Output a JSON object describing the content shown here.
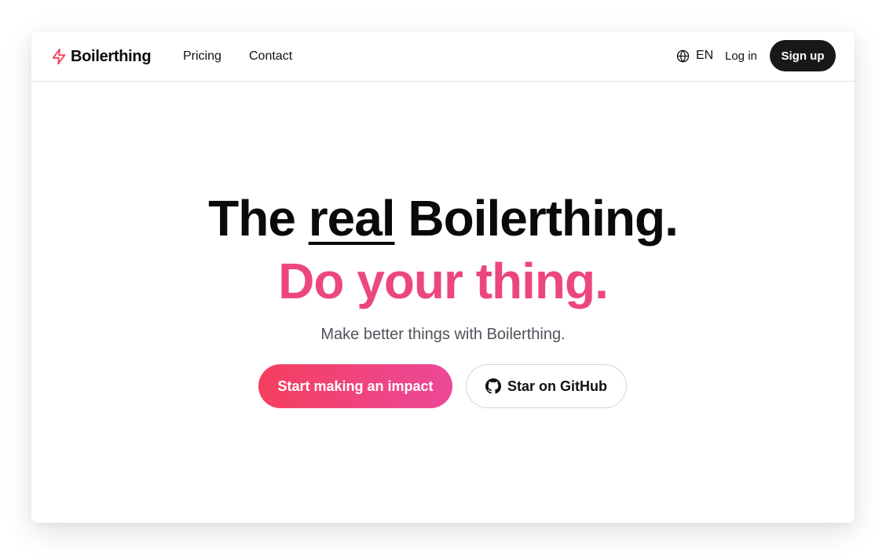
{
  "brand": {
    "name": "Boilerthing",
    "icon": "lightning-bolt-icon",
    "accent_color": "#f43f5e"
  },
  "nav": {
    "links": [
      "Pricing",
      "Contact"
    ],
    "language": {
      "icon": "globe-icon",
      "label": "EN"
    },
    "login_label": "Log in",
    "signup_label": "Sign up"
  },
  "hero": {
    "headline_start": "The ",
    "headline_emphasis": "real",
    "headline_end": " Boilerthing.",
    "tagline": "Do your thing.",
    "tagline_color": "#ec4680",
    "subtext": "Make better things with Boilerthing.",
    "primary_cta": "Start making an impact",
    "primary_gradient": [
      "#f43f5e",
      "#ec4899"
    ],
    "secondary_cta": {
      "icon": "github-icon",
      "label": "Star on GitHub"
    }
  }
}
